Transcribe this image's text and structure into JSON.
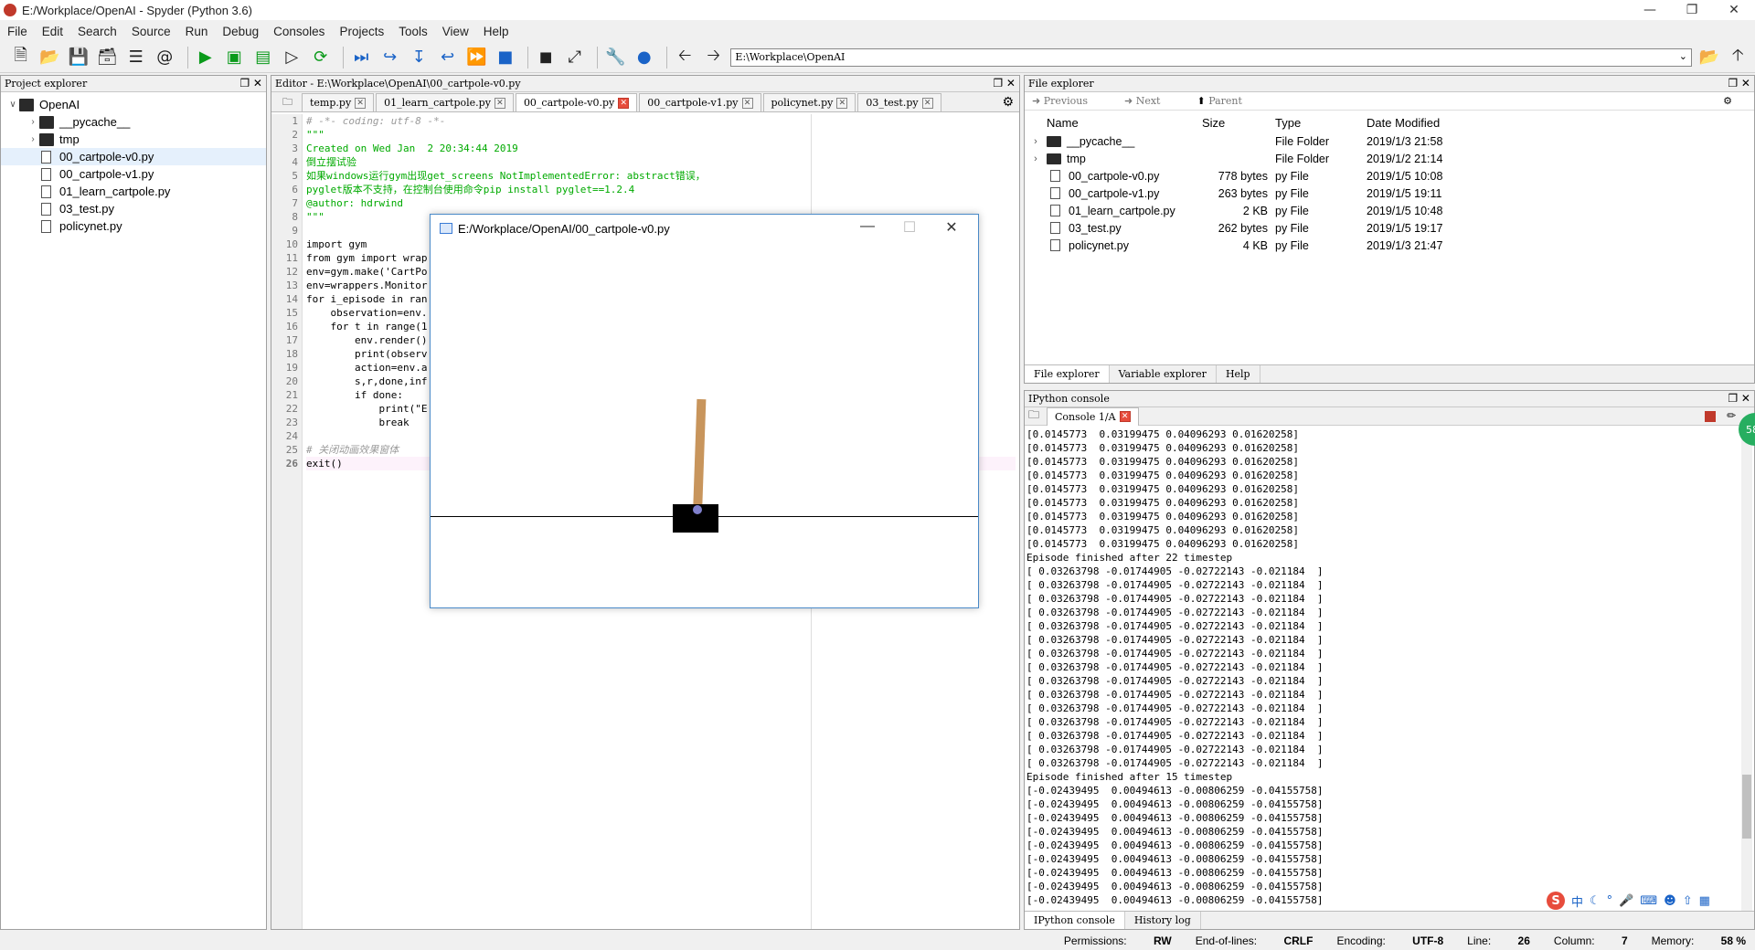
{
  "window": {
    "title": "E:/Workplace/OpenAI - Spyder (Python 3.6)"
  },
  "menu": [
    "File",
    "Edit",
    "Search",
    "Source",
    "Run",
    "Debug",
    "Consoles",
    "Projects",
    "Tools",
    "View",
    "Help"
  ],
  "toolbar": {
    "path_value": "E:\\Workplace\\OpenAI"
  },
  "project_explorer": {
    "header": "Project explorer",
    "items": [
      {
        "label": "OpenAI",
        "type": "folder",
        "level": 0,
        "expanded": true
      },
      {
        "label": "__pycache__",
        "type": "folder",
        "level": 1
      },
      {
        "label": "tmp",
        "type": "folder",
        "level": 1
      },
      {
        "label": "00_cartpole-v0.py",
        "type": "file",
        "level": 1,
        "selected": true
      },
      {
        "label": "00_cartpole-v1.py",
        "type": "file",
        "level": 1
      },
      {
        "label": "01_learn_cartpole.py",
        "type": "file",
        "level": 1
      },
      {
        "label": "03_test.py",
        "type": "file",
        "level": 1
      },
      {
        "label": "policynet.py",
        "type": "file",
        "level": 1
      }
    ]
  },
  "editor": {
    "header": "Editor - E:\\Workplace\\OpenAI\\00_cartpole-v0.py",
    "tabs": [
      "temp.py",
      "01_learn_cartpole.py",
      "00_cartpole-v0.py",
      "00_cartpole-v1.py",
      "policynet.py",
      "03_test.py"
    ],
    "active_tab": 2,
    "lines": [
      "# -*- coding: utf-8 -*-",
      "\"\"\"",
      "Created on Wed Jan  2 20:34:44 2019",
      "倒立摆试验",
      "如果windows运行gym出现get_screens NotImplementedError: abstract错误，",
      "pyglet版本不支持，在控制台使用命令pip install pyglet==1.2.4",
      "@author: hdrwind",
      "\"\"\"",
      "",
      "import gym",
      "from gym import wrap",
      "env=gym.make('CartPo",
      "env=wrappers.Monitor",
      "for i_episode in ran",
      "    observation=env.",
      "    for t in range(1",
      "        env.render()",
      "        print(observ",
      "        action=env.a",
      "        s,r,done,inf",
      "        if done:",
      "            print(\"E",
      "            break",
      "",
      "# 关闭动画效果窗体",
      "exit()"
    ]
  },
  "file_explorer": {
    "header": "File explorer",
    "nav": {
      "previous": "Previous",
      "next": "Next",
      "parent": "Parent"
    },
    "columns": [
      "Name",
      "Size",
      "Type",
      "Date Modified"
    ],
    "rows": [
      {
        "name": "__pycache__",
        "size": "",
        "type": "File Folder",
        "date": "2019/1/3 21:58",
        "folder": true
      },
      {
        "name": "tmp",
        "size": "",
        "type": "File Folder",
        "date": "2019/1/2 21:14",
        "folder": true
      },
      {
        "name": "00_cartpole-v0.py",
        "size": "778 bytes",
        "type": "py File",
        "date": "2019/1/5 10:08"
      },
      {
        "name": "00_cartpole-v1.py",
        "size": "263 bytes",
        "type": "py File",
        "date": "2019/1/5 19:11"
      },
      {
        "name": "01_learn_cartpole.py",
        "size": "2 KB",
        "type": "py File",
        "date": "2019/1/5 10:48"
      },
      {
        "name": "03_test.py",
        "size": "262 bytes",
        "type": "py File",
        "date": "2019/1/5 19:17"
      },
      {
        "name": "policynet.py",
        "size": "4 KB",
        "type": "py File",
        "date": "2019/1/3 21:47"
      }
    ],
    "bottom_tabs": [
      "File explorer",
      "Variable explorer",
      "Help"
    ]
  },
  "ipython": {
    "header": "IPython console",
    "tab": "Console 1/A",
    "lines": [
      "[0.0145773  0.03199475 0.04096293 0.01620258]",
      "[0.0145773  0.03199475 0.04096293 0.01620258]",
      "[0.0145773  0.03199475 0.04096293 0.01620258]",
      "[0.0145773  0.03199475 0.04096293 0.01620258]",
      "[0.0145773  0.03199475 0.04096293 0.01620258]",
      "[0.0145773  0.03199475 0.04096293 0.01620258]",
      "[0.0145773  0.03199475 0.04096293 0.01620258]",
      "[0.0145773  0.03199475 0.04096293 0.01620258]",
      "[0.0145773  0.03199475 0.04096293 0.01620258]",
      "Episode finished after 22 timestep",
      "[ 0.03263798 -0.01744905 -0.02722143 -0.021184  ]",
      "[ 0.03263798 -0.01744905 -0.02722143 -0.021184  ]",
      "[ 0.03263798 -0.01744905 -0.02722143 -0.021184  ]",
      "[ 0.03263798 -0.01744905 -0.02722143 -0.021184  ]",
      "[ 0.03263798 -0.01744905 -0.02722143 -0.021184  ]",
      "[ 0.03263798 -0.01744905 -0.02722143 -0.021184  ]",
      "[ 0.03263798 -0.01744905 -0.02722143 -0.021184  ]",
      "[ 0.03263798 -0.01744905 -0.02722143 -0.021184  ]",
      "[ 0.03263798 -0.01744905 -0.02722143 -0.021184  ]",
      "[ 0.03263798 -0.01744905 -0.02722143 -0.021184  ]",
      "[ 0.03263798 -0.01744905 -0.02722143 -0.021184  ]",
      "[ 0.03263798 -0.01744905 -0.02722143 -0.021184  ]",
      "[ 0.03263798 -0.01744905 -0.02722143 -0.021184  ]",
      "[ 0.03263798 -0.01744905 -0.02722143 -0.021184  ]",
      "[ 0.03263798 -0.01744905 -0.02722143 -0.021184  ]",
      "Episode finished after 15 timestep",
      "[-0.02439495  0.00494613 -0.00806259 -0.04155758]",
      "[-0.02439495  0.00494613 -0.00806259 -0.04155758]",
      "[-0.02439495  0.00494613 -0.00806259 -0.04155758]",
      "[-0.02439495  0.00494613 -0.00806259 -0.04155758]",
      "[-0.02439495  0.00494613 -0.00806259 -0.04155758]",
      "[-0.02439495  0.00494613 -0.00806259 -0.04155758]",
      "[-0.02439495  0.00494613 -0.00806259 -0.04155758]",
      "[-0.02439495  0.00494613 -0.00806259 -0.04155758]",
      "[-0.02439495  0.00494613 -0.00806259 -0.04155758]"
    ],
    "bottom_tabs": [
      "IPython console",
      "History log"
    ]
  },
  "gym_window": {
    "title": "E:/Workplace/OpenAI/00_cartpole-v0.py"
  },
  "statusbar": {
    "permissions_label": "Permissions:",
    "permissions": "RW",
    "eol_label": "End-of-lines:",
    "eol": "CRLF",
    "encoding_label": "Encoding:",
    "encoding": "UTF-8",
    "line_label": "Line:",
    "line": "26",
    "column_label": "Column:",
    "column": "7",
    "memory_label": "Memory:",
    "memory": "58 %"
  },
  "ime": [
    "中"
  ],
  "badge": "58"
}
